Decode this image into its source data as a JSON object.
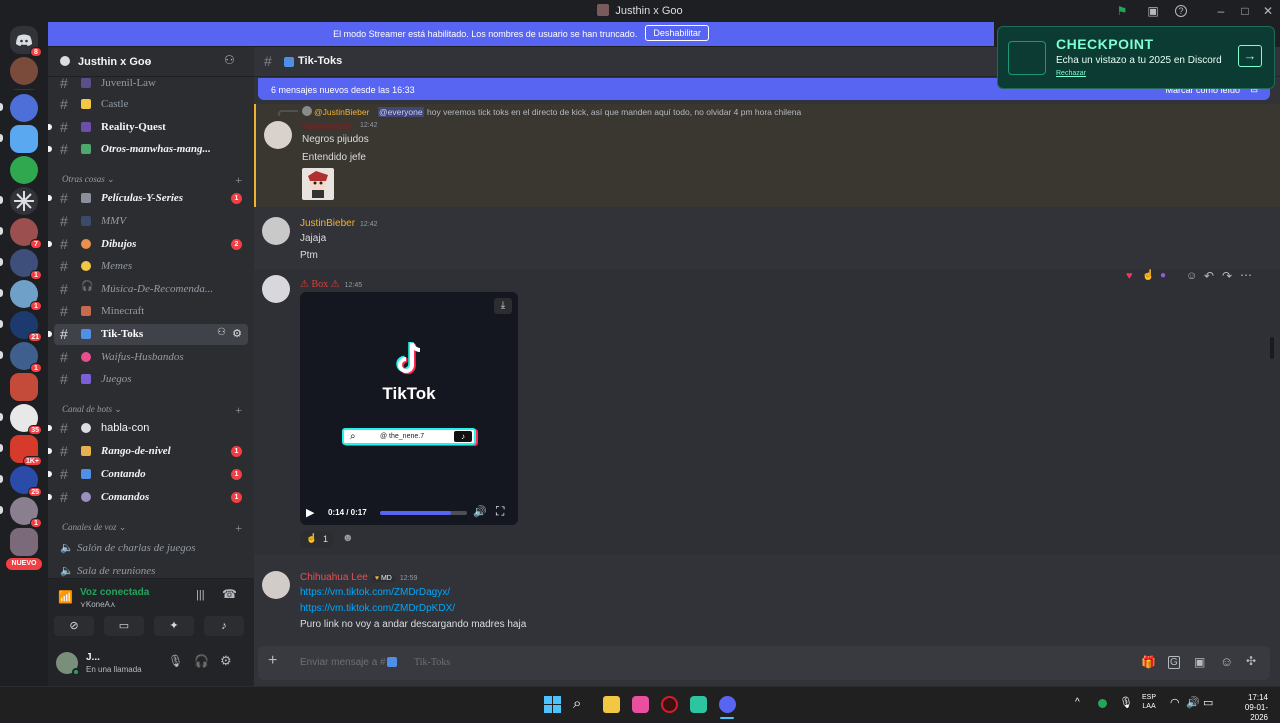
{
  "window": {
    "title": "Justhin x Goo"
  },
  "streamer_banner": {
    "text": "El modo Streamer está habilitado. Los nombres de usuario se han truncado.",
    "button": "Deshabilitar"
  },
  "checkpoint": {
    "title": "CHECKPOINT",
    "subtitle": "Echa un vistazo a tu 2025 en Discord",
    "dismiss": "Rechazar"
  },
  "servers": [
    {
      "badge": "8"
    },
    {
      "badge": ""
    },
    {
      "badge": ""
    },
    {
      "badge": ""
    },
    {
      "badge": ""
    },
    {
      "badge": ""
    },
    {
      "badge": "7"
    },
    {
      "badge": "1"
    },
    {
      "badge": "1"
    },
    {
      "badge": "21"
    },
    {
      "badge": "1"
    },
    {
      "badge": ""
    },
    {
      "badge": "35"
    },
    {
      "badge": "1K+"
    },
    {
      "badge": "25"
    },
    {
      "badge": "1"
    },
    {
      "badge": "NUEVO"
    }
  ],
  "guild": {
    "name": "Justhin x Goo"
  },
  "channels": [
    {
      "name": "Juvenil-Law",
      "unread": false,
      "badge": ""
    },
    {
      "name": "Castle",
      "unread": false,
      "badge": ""
    },
    {
      "name": "Reality-Quest",
      "unread": true,
      "badge": ""
    },
    {
      "name": "Otros-manwhas-mang...",
      "unread": true,
      "badge": ""
    }
  ],
  "categories": {
    "otras": "Otras cosas",
    "bots": "Canal de bots",
    "voz": "Canales de voz"
  },
  "channels_otras": [
    {
      "name": "Películas-Y-Series",
      "badge": "1"
    },
    {
      "name": "MMV",
      "badge": ""
    },
    {
      "name": "Dibujos",
      "badge": "2"
    },
    {
      "name": "Memes",
      "badge": ""
    },
    {
      "name": "Música-De-Recomenda...",
      "badge": ""
    },
    {
      "name": "Minecraft",
      "badge": ""
    },
    {
      "name": "Tik-Toks",
      "badge": ""
    },
    {
      "name": "Waifus-Husbandos",
      "badge": ""
    },
    {
      "name": "Juegos",
      "badge": ""
    }
  ],
  "channels_bots": [
    {
      "name": "habla-con",
      "badge": ""
    },
    {
      "name": "Rango-de-nivel",
      "badge": "1"
    },
    {
      "name": "Contando",
      "badge": "1"
    },
    {
      "name": "Comandos",
      "badge": "1"
    }
  ],
  "voice_channels": [
    "Salón de charlas de juegos",
    "Sala de reuniones"
  ],
  "voice_status": {
    "title": "Voz conectada",
    "channel": "⋎KoneA⋏"
  },
  "user": {
    "name": "J...",
    "status": "En una llamada"
  },
  "channel_header": {
    "name": "Tik-Toks"
  },
  "new_messages": {
    "text": "6 mensajes nuevos desde las 16:33",
    "action": "Marcar como leído"
  },
  "messages": {
    "reply_author": "@JustinBieber",
    "reply_mention": "@everyone",
    "reply_text": "hoy veremos tick toks en el directo de kick, así que manden aquí todo, no olvidar 4 pm hora chilena",
    "m1_time": "12:42",
    "m1_lines": [
      "Negros pijudos",
      "Entendido jefe"
    ],
    "m2_author": "JustinBieber",
    "m2_time": "12:42",
    "m2_lines": [
      "Jajaja",
      "Ptm"
    ],
    "m3_author": "⚠ Box ⚠",
    "m3_time": "12:45",
    "video_brand": "TikTok",
    "video_handle": "@ the_nene.7",
    "video_time": "0:14 / 0:17",
    "video_progress": 0.82,
    "reaction_count": "1",
    "m4_author": "Chihuahua Lee",
    "m4_tag": "MD",
    "m4_time": "12:59",
    "m4_link1": "https://vm.tiktok.com/ZMDrDagyx/",
    "m4_link2": "https://vm.tiktok.com/ZMDrDpKDX/",
    "m4_text": "Puro link no voy a andar descargando madres haja"
  },
  "composer": {
    "placeholder": "Enviar mensaje a #",
    "channel": "Tik-Toks"
  },
  "taskbar": {
    "lang1": "ESP",
    "lang2": "LAA",
    "time": "17:14",
    "date": "09-01-2026"
  }
}
